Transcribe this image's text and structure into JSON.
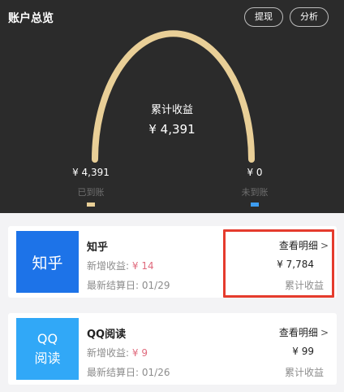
{
  "header": {
    "title": "账户总览",
    "withdraw_label": "提现",
    "analyze_label": "分析"
  },
  "summary": {
    "total_label": "累计收益",
    "total_value": "¥ 4,391",
    "received_value": "¥ 4,391",
    "received_label": "已到账",
    "pending_value": "¥ 0",
    "pending_label": "未到账",
    "colors": {
      "received": "#e9cf97",
      "pending": "#3d9cf0"
    }
  },
  "accounts": [
    {
      "logo_text": "知乎",
      "name": "知乎",
      "new_income_label": "新增收益:",
      "new_income_value": "¥ 14",
      "settle_label": "最新结算日:",
      "settle_value": "01/29",
      "detail_link": "查看明细",
      "total_value": "¥ 7,784",
      "total_label": "累计收益"
    },
    {
      "logo_text_line1": "QQ",
      "logo_text_line2": "阅读",
      "name": "QQ阅读",
      "new_income_label": "新增收益:",
      "new_income_value": "¥ 9",
      "settle_label": "最新结算日:",
      "settle_value": "01/26",
      "detail_link": "查看明细",
      "total_value": "¥ 99",
      "total_label": "累计收益"
    }
  ],
  "icons": {
    "chevron": "chevron-right-icon"
  }
}
